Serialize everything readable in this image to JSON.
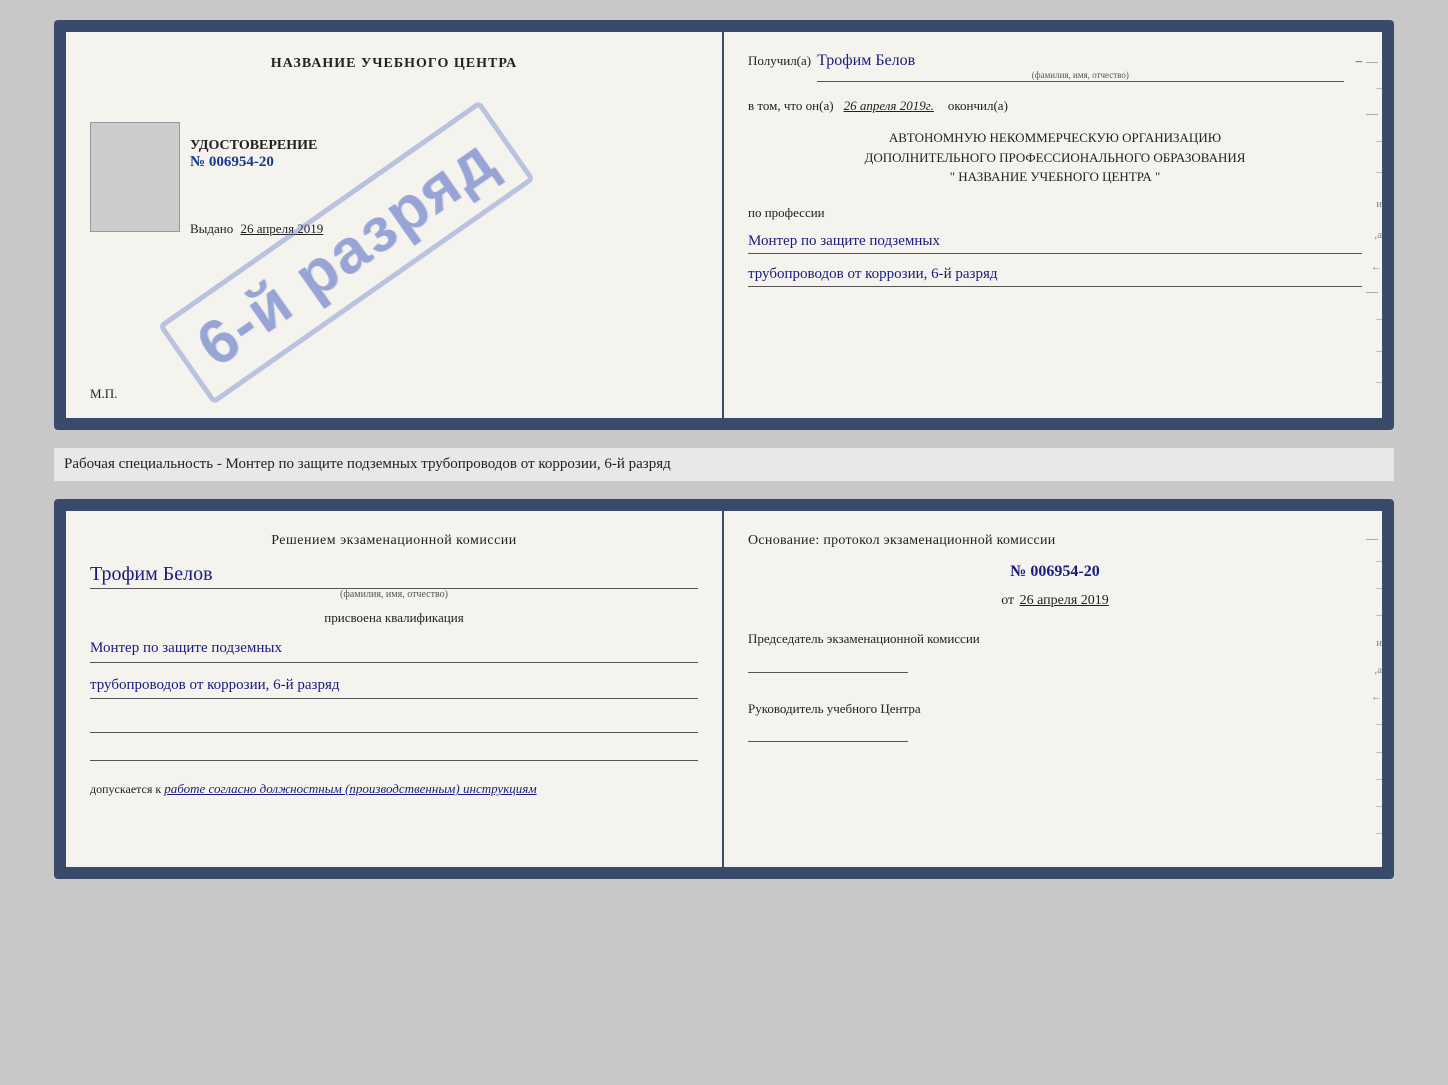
{
  "cert": {
    "left": {
      "title": "НАЗВАНИЕ УЧЕБНОГО ЦЕНТРА",
      "stamp_text": "6-й разряд",
      "udost_label": "УДОСТОВЕРЕНИЕ",
      "udost_num": "№ 006954-20",
      "vydano_label": "Выдано",
      "vydano_date": "26 апреля 2019",
      "mp": "М.П."
    },
    "right": {
      "poluchil_label": "Получил(а)",
      "recipient_name": "Трофим Белов",
      "recipient_sublabel": "(фамилия, имя, отчество)",
      "dash1": "–",
      "vtom_label": "в том, что он(а)",
      "vtom_date": "26 апреля 2019г.",
      "okonchil": "окончил(а)",
      "org_line1": "АВТОНОМНУЮ НЕКОММЕРЧЕСКУЮ ОРГАНИЗАЦИЮ",
      "org_line2": "ДОПОЛНИТЕЛЬНОГО ПРОФЕССИОНАЛЬНОГО ОБРАЗОВАНИЯ",
      "org_name": "\"  НАЗВАНИЕ УЧЕБНОГО ЦЕНТРА  \"",
      "po_professii": "по профессии",
      "profession_line1": "Монтер по защите подземных",
      "profession_line2": "трубопроводов от коррозии, 6-й разряд"
    }
  },
  "info_strip": {
    "text": "Рабочая специальность - Монтер по защите подземных трубопроводов от коррозии, 6-й разряд"
  },
  "exam": {
    "left": {
      "title": "Решением  экзаменационной  комиссии",
      "name": "Трофим Белов",
      "name_sublabel": "(фамилия, имя, отчество)",
      "assigned_label": "присвоена квалификация",
      "qualification_line1": "Монтер по защите подземных",
      "qualification_line2": "трубопроводов от коррозии, 6-й разряд",
      "allowed_prefix": "допускается к",
      "allowed_text": "работе согласно должностным (производственным) инструкциям"
    },
    "right": {
      "title": "Основание: протокол  экзаменационной  комиссии",
      "num": "№  006954-20",
      "date_prefix": "от",
      "date": "26 апреля 2019",
      "chairman_label": "Председатель экзаменационной комиссии",
      "head_label": "Руководитель учебного Центра"
    }
  },
  "side_chars": {
    "right_chars": [
      "–",
      "–",
      "–",
      "и",
      "а",
      "←",
      "–",
      "–",
      "–",
      "–",
      "–"
    ]
  }
}
